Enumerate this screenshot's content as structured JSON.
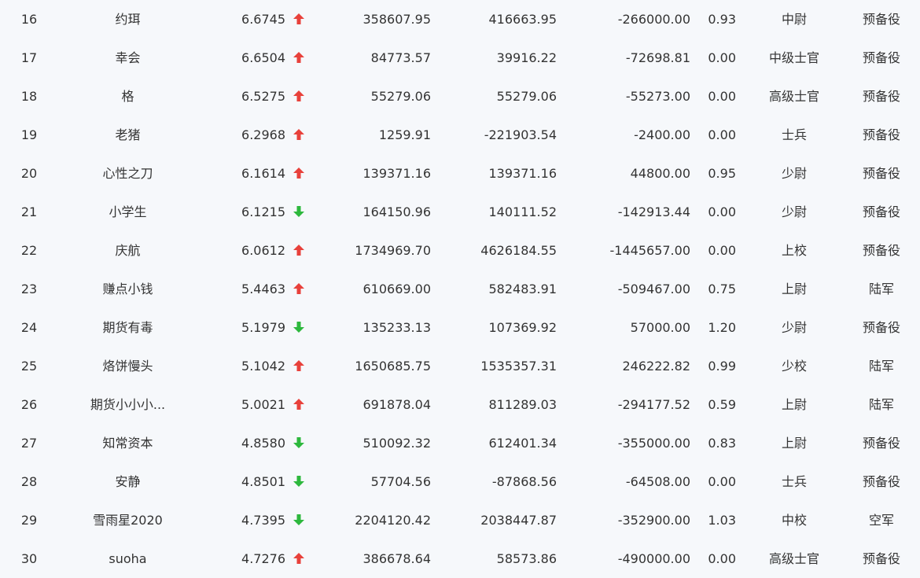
{
  "colors": {
    "background": "#f6f8fb",
    "text": "#333333",
    "up": "#e8413b",
    "down": "#2db83d"
  },
  "icons": {
    "up": "arrow-up-icon",
    "down": "arrow-down-icon"
  },
  "rows": [
    {
      "rank": "16",
      "name": "约珥",
      "score": "6.6745",
      "trend": "up",
      "val_a": "358607.95",
      "val_b": "416663.95",
      "val_c": "-266000.00",
      "val_d": "0.93",
      "rank_title": "中尉",
      "force": "预备役"
    },
    {
      "rank": "17",
      "name": "幸会",
      "score": "6.6504",
      "trend": "up",
      "val_a": "84773.57",
      "val_b": "39916.22",
      "val_c": "-72698.81",
      "val_d": "0.00",
      "rank_title": "中级士官",
      "force": "预备役"
    },
    {
      "rank": "18",
      "name": "格",
      "score": "6.5275",
      "trend": "up",
      "val_a": "55279.06",
      "val_b": "55279.06",
      "val_c": "-55273.00",
      "val_d": "0.00",
      "rank_title": "高级士官",
      "force": "预备役"
    },
    {
      "rank": "19",
      "name": "老猪",
      "score": "6.2968",
      "trend": "up",
      "val_a": "1259.91",
      "val_b": "-221903.54",
      "val_c": "-2400.00",
      "val_d": "0.00",
      "rank_title": "士兵",
      "force": "预备役"
    },
    {
      "rank": "20",
      "name": "心性之刀",
      "score": "6.1614",
      "trend": "up",
      "val_a": "139371.16",
      "val_b": "139371.16",
      "val_c": "44800.00",
      "val_d": "0.95",
      "rank_title": "少尉",
      "force": "预备役"
    },
    {
      "rank": "21",
      "name": "小学生",
      "score": "6.1215",
      "trend": "down",
      "val_a": "164150.96",
      "val_b": "140111.52",
      "val_c": "-142913.44",
      "val_d": "0.00",
      "rank_title": "少尉",
      "force": "预备役"
    },
    {
      "rank": "22",
      "name": "庆航",
      "score": "6.0612",
      "trend": "up",
      "val_a": "1734969.70",
      "val_b": "4626184.55",
      "val_c": "-1445657.00",
      "val_d": "0.00",
      "rank_title": "上校",
      "force": "预备役"
    },
    {
      "rank": "23",
      "name": "赚点小钱",
      "score": "5.4463",
      "trend": "up",
      "val_a": "610669.00",
      "val_b": "582483.91",
      "val_c": "-509467.00",
      "val_d": "0.75",
      "rank_title": "上尉",
      "force": "陆军"
    },
    {
      "rank": "24",
      "name": "期货有毒",
      "score": "5.1979",
      "trend": "down",
      "val_a": "135233.13",
      "val_b": "107369.92",
      "val_c": "57000.00",
      "val_d": "1.20",
      "rank_title": "少尉",
      "force": "预备役"
    },
    {
      "rank": "25",
      "name": "烙饼慢头",
      "score": "5.1042",
      "trend": "up",
      "val_a": "1650685.75",
      "val_b": "1535357.31",
      "val_c": "246222.82",
      "val_d": "0.99",
      "rank_title": "少校",
      "force": "陆军"
    },
    {
      "rank": "26",
      "name": "期货小小小...",
      "score": "5.0021",
      "trend": "up",
      "val_a": "691878.04",
      "val_b": "811289.03",
      "val_c": "-294177.52",
      "val_d": "0.59",
      "rank_title": "上尉",
      "force": "陆军"
    },
    {
      "rank": "27",
      "name": "知常资本",
      "score": "4.8580",
      "trend": "down",
      "val_a": "510092.32",
      "val_b": "612401.34",
      "val_c": "-355000.00",
      "val_d": "0.83",
      "rank_title": "上尉",
      "force": "预备役"
    },
    {
      "rank": "28",
      "name": "安静",
      "score": "4.8501",
      "trend": "down",
      "val_a": "57704.56",
      "val_b": "-87868.56",
      "val_c": "-64508.00",
      "val_d": "0.00",
      "rank_title": "士兵",
      "force": "预备役"
    },
    {
      "rank": "29",
      "name": "雪雨星2020",
      "score": "4.7395",
      "trend": "down",
      "val_a": "2204120.42",
      "val_b": "2038447.87",
      "val_c": "-352900.00",
      "val_d": "1.03",
      "rank_title": "中校",
      "force": "空军"
    },
    {
      "rank": "30",
      "name": "suoha",
      "score": "4.7276",
      "trend": "up",
      "val_a": "386678.64",
      "val_b": "58573.86",
      "val_c": "-490000.00",
      "val_d": "0.00",
      "rank_title": "高级士官",
      "force": "预备役"
    }
  ]
}
